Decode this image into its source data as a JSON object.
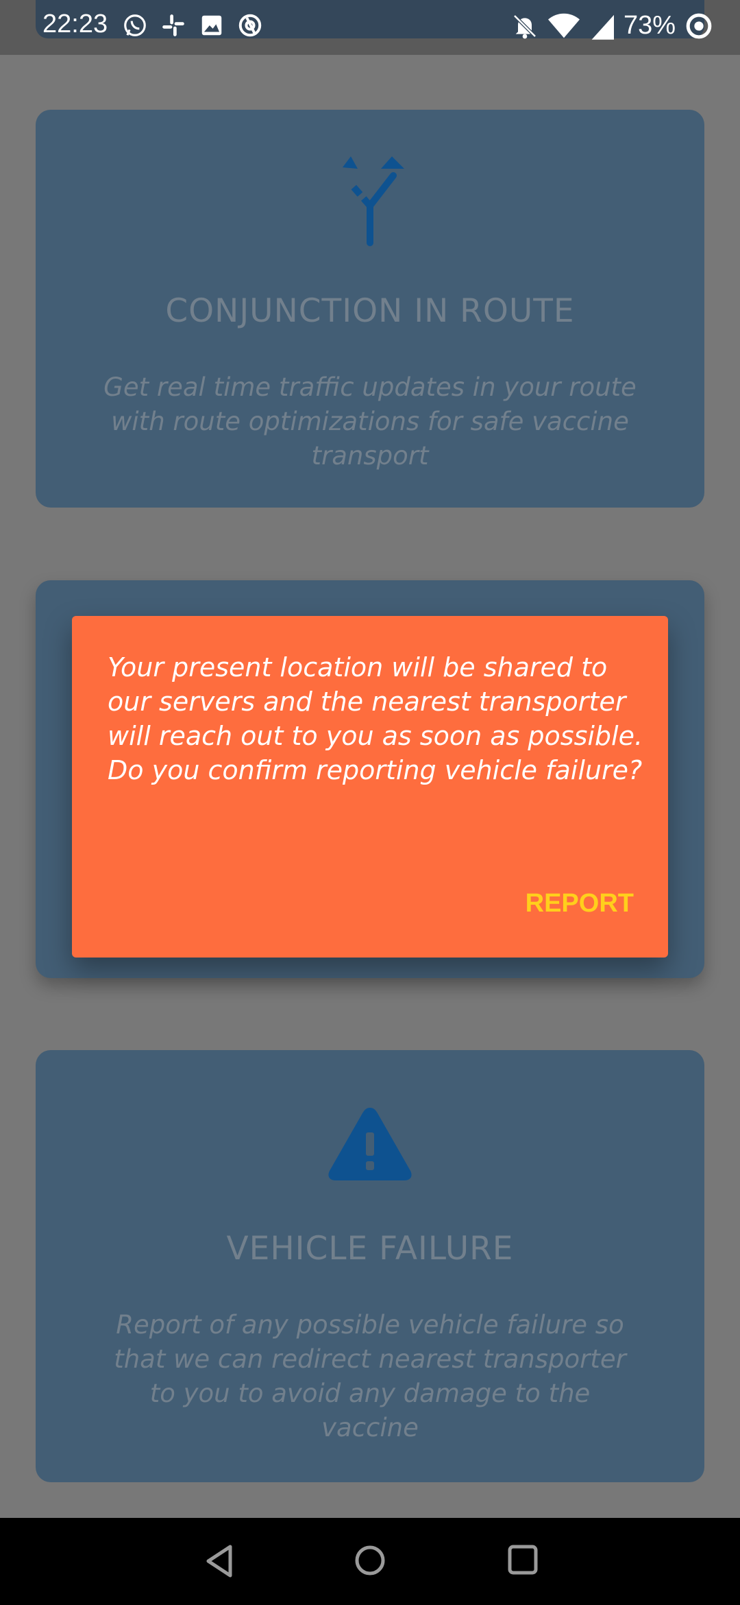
{
  "status_bar": {
    "time": "22:23",
    "battery": "73%",
    "left_icons": [
      "whatsapp-icon",
      "slack-icon",
      "image-icon",
      "at-icon"
    ],
    "right_icons": [
      "bell-off-icon",
      "wifi-icon",
      "signal-icon",
      "battery-ring-icon"
    ]
  },
  "cards": [
    {
      "icon": "route-split-icon",
      "title": "CONJUNCTION IN ROUTE",
      "description": "Get real time traffic updates in your route with route optimizations for safe vaccine transport"
    },
    {
      "icon": "",
      "title": "",
      "description": ""
    },
    {
      "icon": "warning-icon",
      "title": "VEHICLE FAILURE",
      "description": "Report of any possible vehicle failure so that we can redirect nearest transporter to you to avoid any damage to the vaccine"
    }
  ],
  "dialog": {
    "message": "Your present location will be shared to our servers and the nearest transporter will reach out to you as soon as possible. Do you confirm reporting vehicle failure?",
    "confirm_label": "REPORT"
  },
  "colors": {
    "scrim": "#787878",
    "card": "#435e75",
    "icon": "#0e5290",
    "dialog": "#fe6d3e",
    "dialog_button": "#ffcf1c"
  },
  "nav_bar": {
    "buttons": [
      "back-icon",
      "home-icon",
      "recents-icon"
    ]
  }
}
